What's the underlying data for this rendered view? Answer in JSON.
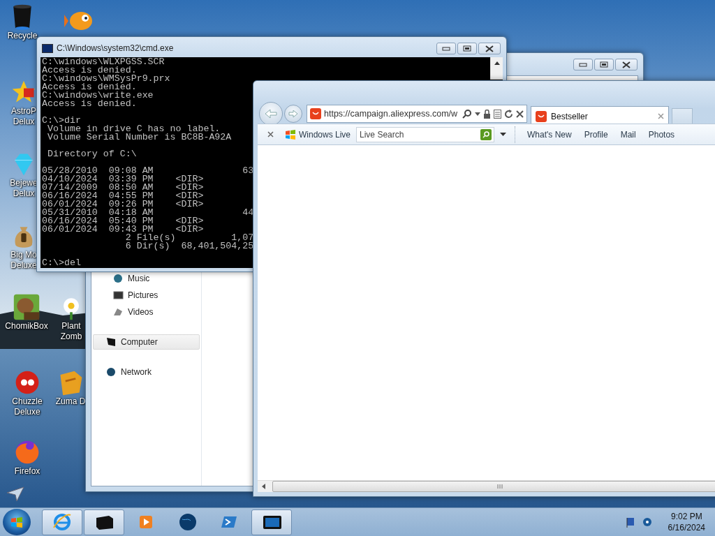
{
  "desktop_icons": [
    {
      "lines": [
        "Recycle"
      ]
    },
    {
      "lines": [
        "AstroP",
        "Delux"
      ]
    },
    {
      "lines": [
        "Bejewe",
        "Delux"
      ]
    },
    {
      "lines": [
        "Big Mo",
        "Deluxe"
      ]
    },
    {
      "lines": [
        "ChomikBox"
      ]
    },
    {
      "lines": [
        "Plant",
        "Zomb"
      ]
    },
    {
      "lines": [
        "Chuzzle",
        "Deluxe"
      ]
    },
    {
      "lines": [
        "Zuma D"
      ]
    },
    {
      "lines": [
        "Firefox"
      ]
    }
  ],
  "explorer": {
    "nav": [
      {
        "label": "Music",
        "kind": "sub",
        "selected": false
      },
      {
        "label": "Pictures",
        "kind": "sub",
        "selected": false
      },
      {
        "label": "Videos",
        "kind": "sub",
        "selected": false
      },
      {
        "label": "Computer",
        "kind": "top",
        "selected": true
      },
      {
        "label": "Network",
        "kind": "top",
        "selected": false
      }
    ]
  },
  "cmd": {
    "title": "C:\\Windows\\system32\\cmd.exe",
    "blocks": [
      [
        "C:\\windows\\WLXPGSS.SCR",
        "Access is denied.",
        "C:\\windows\\WMSysPr9.prx",
        "Access is denied.",
        "C:\\windows\\write.exe",
        "Access is denied."
      ],
      [
        "C:\\>dir",
        " Volume in drive C has no label.",
        " Volume Serial Number is BC8B-A92A"
      ],
      [
        " Directory of C:\\"
      ],
      [
        "05/28/2010  09:08 AM                63",
        "04/10/2024  03:39 PM    <DIR>",
        "07/14/2009  08:50 AM    <DIR>",
        "06/16/2024  04:55 PM    <DIR>",
        "06/01/2024  09:26 PM    <DIR>",
        "05/31/2010  04:18 AM                44",
        "06/16/2024  05:40 PM    <DIR>",
        "06/01/2024  09:43 PM    <DIR>",
        "               2 File(s)          1,07",
        "               6 Dir(s)  68,401,504,25"
      ],
      [
        "C:\\>del"
      ]
    ]
  },
  "browser": {
    "address": "https://campaign.aliexpress.com/w",
    "tab": {
      "title": "Bestseller"
    },
    "toolbar": {
      "brand": "Windows Live",
      "search_placeholder": "Live Search",
      "links": [
        "What's New",
        "Profile",
        "Mail",
        "Photos"
      ]
    }
  },
  "taskbar": {
    "apps": [
      {
        "running": true
      },
      {
        "running": true
      },
      {
        "running": false
      },
      {
        "running": false
      },
      {
        "running": false
      },
      {
        "running": true
      }
    ],
    "time": "9:02 PM",
    "date": "6/16/2024"
  }
}
